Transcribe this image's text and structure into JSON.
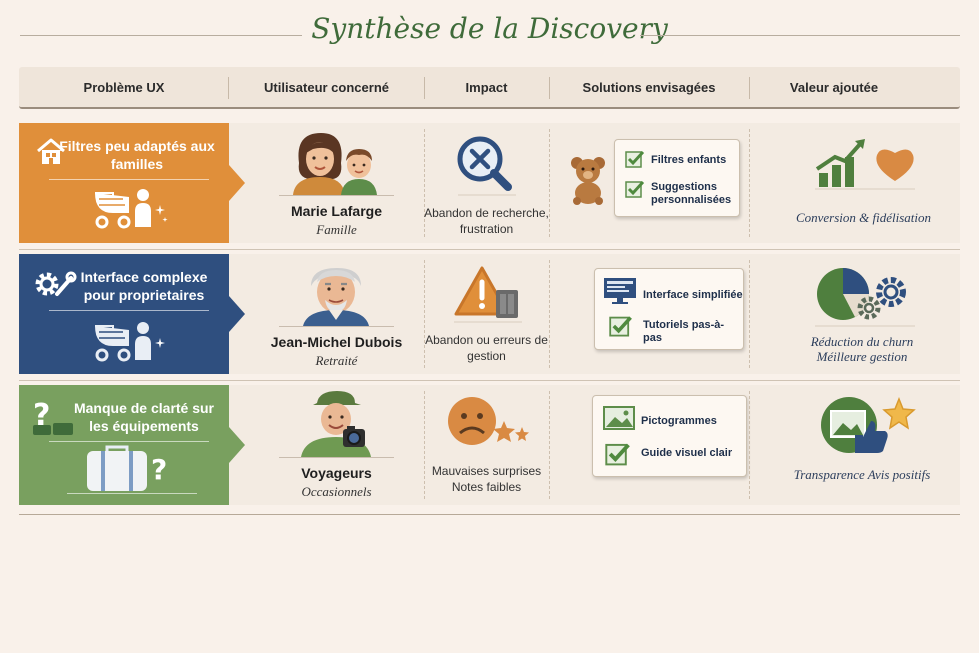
{
  "title": "Synthèse de la Discovery",
  "headers": [
    "Problème UX",
    "Utilisateur concerné",
    "Impact",
    "Solutions envisagées",
    "Valeur ajoutée"
  ],
  "colors": {
    "orange": "#e08f3a",
    "blue": "#2f4f7f",
    "green": "#79a05f",
    "title_green": "#3f6b3a",
    "background": "#f9f1ea"
  },
  "rows": [
    {
      "problem": "Filtres peu adaptés aux familles",
      "problem_icons": [
        "house-icon",
        "stroller-icon"
      ],
      "user_name": "Marie Lafarge",
      "user_role": "Famille",
      "user_icon": "mother-child-avatar",
      "impact": "Abandon de recherche, frustration",
      "impact_icon": "magnifier-cross-icon",
      "solution_icon": "teddy-bear-icon",
      "solutions": [
        "Filtres enfants",
        "Suggestions personnalisées"
      ],
      "value": "Conversion & fidélisation",
      "value_icons": [
        "growth-chart-icon",
        "heart-icon"
      ]
    },
    {
      "problem": "Interface complexe pour proprietaires",
      "problem_icons": [
        "gear-wrench-icon",
        "stroller-icon"
      ],
      "user_name": "Jean-Michel Dubois",
      "user_role": "Retraité",
      "user_icon": "senior-man-avatar",
      "impact": "Abandon ou erreurs de gestion",
      "impact_icon": "warning-icon",
      "solutions": [
        "Interface simplifiée",
        "Tutoriels pas-à-pas"
      ],
      "value": "Réduction du churn Méilleure gestion",
      "value_icons": [
        "pie-chart-icon",
        "gears-icon"
      ]
    },
    {
      "problem": "Manque de clarté sur les équipements",
      "problem_icons": [
        "question-icon",
        "suitcase-icon"
      ],
      "user_name": "Voyageurs",
      "user_role": "Occasionnels",
      "user_icon": "traveler-camera-avatar",
      "impact": "Mauvaises surprises Notes faibles",
      "impact_icon": "sad-face-stars-icon",
      "solutions": [
        "Pictogrammes",
        "Guide visuel clair"
      ],
      "value": "Transparence Avis positifs",
      "value_icons": [
        "picture-icon",
        "thumbs-up-icon",
        "star-icon"
      ]
    }
  ]
}
